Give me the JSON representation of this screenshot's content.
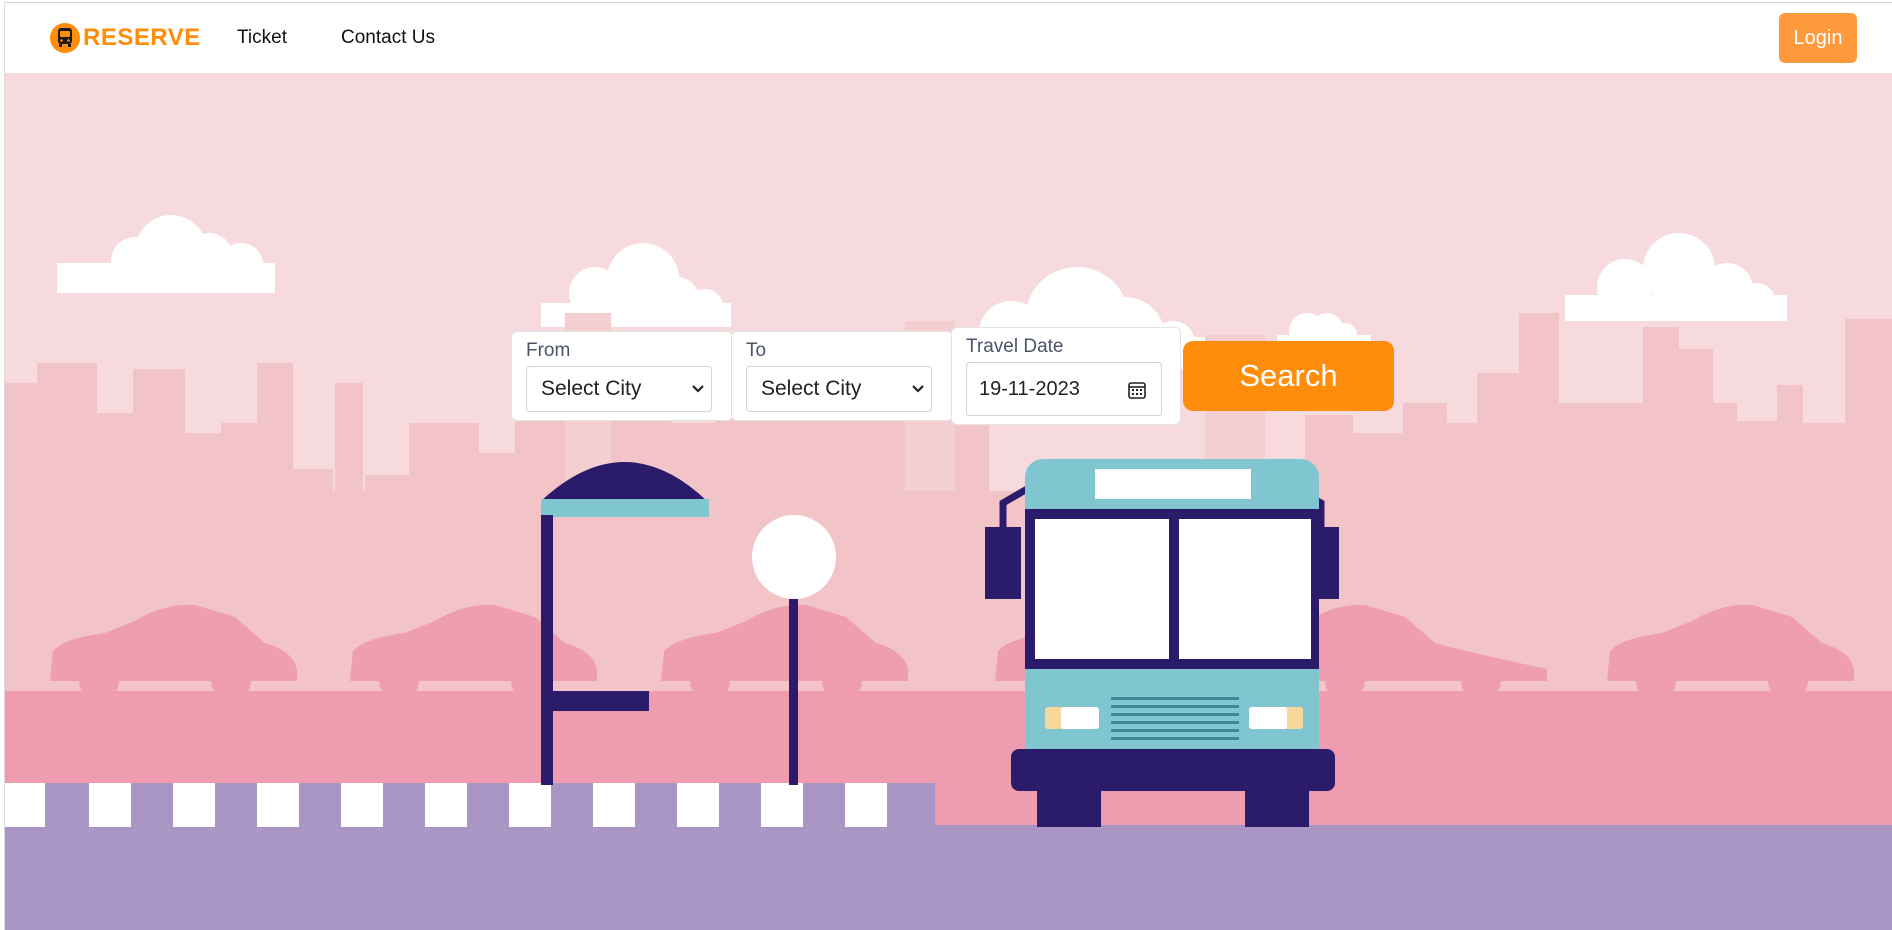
{
  "navbar": {
    "brand": "RESERVE",
    "links": [
      {
        "label": "Ticket"
      },
      {
        "label": "Contact Us"
      }
    ],
    "login_label": "Login"
  },
  "search_form": {
    "from": {
      "label": "From",
      "value": "Select City"
    },
    "to": {
      "label": "To",
      "value": "Select City"
    },
    "travel_date": {
      "label": "Travel Date",
      "value": "19-11-2023"
    },
    "search_label": "Search"
  },
  "colors": {
    "accent": "#ff8c0a",
    "sky": "#f7dade",
    "buildings": "#f2c4c8",
    "road": "#f09cb0",
    "ground": "#a996c4",
    "navy": "#2a1c6b",
    "bus_teal": "#7fc6d0"
  },
  "icons": {
    "brand": "bus-icon",
    "select": "chevron-down-icon",
    "date": "calendar-icon"
  }
}
